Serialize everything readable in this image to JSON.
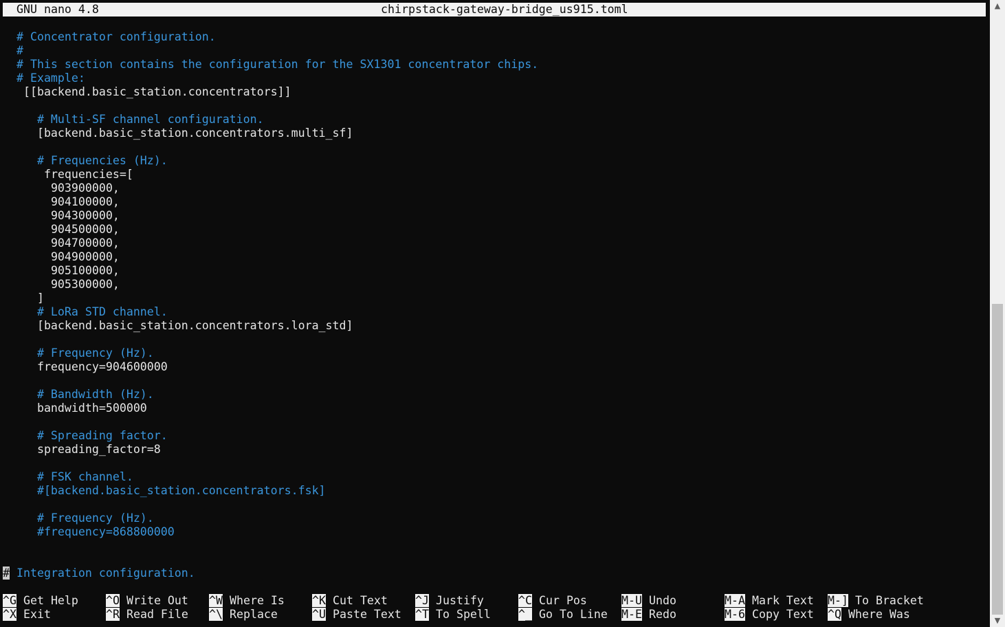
{
  "title_bar": {
    "version": "GNU nano 4.8",
    "filename": "chirpstack-gateway-bridge_us915.toml"
  },
  "editor_lines": [
    {
      "indent": "  ",
      "text": "# Concentrator configuration.",
      "kind": "comment"
    },
    {
      "indent": "  ",
      "text": "#",
      "kind": "comment"
    },
    {
      "indent": "  ",
      "text": "# This section contains the configuration for the SX1301 concentrator chips.",
      "kind": "comment"
    },
    {
      "indent": "  ",
      "text": "# Example:",
      "kind": "comment"
    },
    {
      "indent": "   ",
      "text": "[[backend.basic_station.concentrators]]",
      "kind": "plain"
    },
    {
      "indent": "",
      "text": "",
      "kind": "plain"
    },
    {
      "indent": "     ",
      "text": "# Multi-SF channel configuration.",
      "kind": "comment"
    },
    {
      "indent": "     ",
      "text": "[backend.basic_station.concentrators.multi_sf]",
      "kind": "plain"
    },
    {
      "indent": "",
      "text": "",
      "kind": "plain"
    },
    {
      "indent": "     ",
      "text": "# Frequencies (Hz).",
      "kind": "comment"
    },
    {
      "indent": "      ",
      "text": "frequencies=[",
      "kind": "plain"
    },
    {
      "indent": "       ",
      "text": "903900000,",
      "kind": "plain"
    },
    {
      "indent": "       ",
      "text": "904100000,",
      "kind": "plain"
    },
    {
      "indent": "       ",
      "text": "904300000,",
      "kind": "plain"
    },
    {
      "indent": "       ",
      "text": "904500000,",
      "kind": "plain"
    },
    {
      "indent": "       ",
      "text": "904700000,",
      "kind": "plain"
    },
    {
      "indent": "       ",
      "text": "904900000,",
      "kind": "plain"
    },
    {
      "indent": "       ",
      "text": "905100000,",
      "kind": "plain"
    },
    {
      "indent": "       ",
      "text": "905300000,",
      "kind": "plain"
    },
    {
      "indent": "     ",
      "text": "]",
      "kind": "plain"
    },
    {
      "indent": "     ",
      "text": "# LoRa STD channel.",
      "kind": "comment"
    },
    {
      "indent": "     ",
      "text": "[backend.basic_station.concentrators.lora_std]",
      "kind": "plain"
    },
    {
      "indent": "",
      "text": "",
      "kind": "plain"
    },
    {
      "indent": "     ",
      "text": "# Frequency (Hz).",
      "kind": "comment"
    },
    {
      "indent": "     ",
      "text": "frequency=904600000",
      "kind": "plain"
    },
    {
      "indent": "",
      "text": "",
      "kind": "plain"
    },
    {
      "indent": "     ",
      "text": "# Bandwidth (Hz).",
      "kind": "comment"
    },
    {
      "indent": "     ",
      "text": "bandwidth=500000",
      "kind": "plain"
    },
    {
      "indent": "",
      "text": "",
      "kind": "plain"
    },
    {
      "indent": "     ",
      "text": "# Spreading factor.",
      "kind": "comment"
    },
    {
      "indent": "     ",
      "text": "spreading_factor=8",
      "kind": "plain"
    },
    {
      "indent": "",
      "text": "",
      "kind": "plain"
    },
    {
      "indent": "     ",
      "text": "# FSK channel.",
      "kind": "comment"
    },
    {
      "indent": "     ",
      "text": "#[backend.basic_station.concentrators.fsk]",
      "kind": "comment"
    },
    {
      "indent": "",
      "text": "",
      "kind": "plain"
    },
    {
      "indent": "     ",
      "text": "# Frequency (Hz).",
      "kind": "comment"
    },
    {
      "indent": "     ",
      "text": "#frequency=868800000",
      "kind": "comment"
    },
    {
      "indent": "",
      "text": "",
      "kind": "plain"
    },
    {
      "indent": "",
      "text": "",
      "kind": "plain"
    },
    {
      "indent": "",
      "text": "# Integration configuration.",
      "kind": "cursor-line"
    }
  ],
  "shortcuts_row1": [
    {
      "key": "^G",
      "label": "Get Help"
    },
    {
      "key": "^O",
      "label": "Write Out"
    },
    {
      "key": "^W",
      "label": "Where Is"
    },
    {
      "key": "^K",
      "label": "Cut Text"
    },
    {
      "key": "^J",
      "label": "Justify"
    },
    {
      "key": "^C",
      "label": "Cur Pos"
    },
    {
      "key": "M-U",
      "label": "Undo"
    },
    {
      "key": "M-A",
      "label": "Mark Text"
    },
    {
      "key": "M-]",
      "label": "To Bracket"
    }
  ],
  "shortcuts_row2": [
    {
      "key": "^X",
      "label": "Exit"
    },
    {
      "key": "^R",
      "label": "Read File"
    },
    {
      "key": "^\\",
      "label": "Replace"
    },
    {
      "key": "^U",
      "label": "Paste Text"
    },
    {
      "key": "^T",
      "label": "To Spell"
    },
    {
      "key": "^_",
      "label": "Go To Line"
    },
    {
      "key": "M-E",
      "label": "Redo"
    },
    {
      "key": "M-6",
      "label": "Copy Text"
    },
    {
      "key": "^Q",
      "label": "Where Was"
    }
  ],
  "colors": {
    "background": "#0c0c0c",
    "foreground": "#e6e6e6",
    "comment": "#3a96dd",
    "titlebar": "#f2f2f2"
  },
  "scrollbar": {
    "up_icon": "triangle-up-icon",
    "down_icon": "triangle-down-icon",
    "position_fraction": 0.48
  }
}
